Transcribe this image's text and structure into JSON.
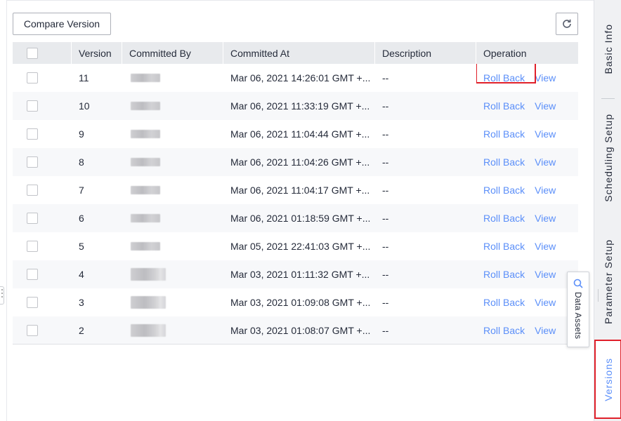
{
  "toolbar": {
    "compare_label": "Compare Version",
    "refresh_icon": "refresh-icon"
  },
  "table": {
    "headers": {
      "version": "Version",
      "committed_by": "Committed By",
      "committed_at": "Committed At",
      "description": "Description",
      "operation": "Operation"
    },
    "rows": [
      {
        "version": "11",
        "committed_at": "Mar 06, 2021 14:26:01 GMT +...",
        "description": "--",
        "rollback": "Roll Back",
        "view": "View"
      },
      {
        "version": "10",
        "committed_at": "Mar 06, 2021 11:33:19 GMT +...",
        "description": "--",
        "rollback": "Roll Back",
        "view": "View"
      },
      {
        "version": "9",
        "committed_at": "Mar 06, 2021 11:04:44 GMT +...",
        "description": "--",
        "rollback": "Roll Back",
        "view": "View"
      },
      {
        "version": "8",
        "committed_at": "Mar 06, 2021 11:04:26 GMT +...",
        "description": "--",
        "rollback": "Roll Back",
        "view": "View"
      },
      {
        "version": "7",
        "committed_at": "Mar 06, 2021 11:04:17 GMT +...",
        "description": "--",
        "rollback": "Roll Back",
        "view": "View"
      },
      {
        "version": "6",
        "committed_at": "Mar 06, 2021 01:18:59 GMT +...",
        "description": "--",
        "rollback": "Roll Back",
        "view": "View"
      },
      {
        "version": "5",
        "committed_at": "Mar 05, 2021 22:41:03 GMT +...",
        "description": "--",
        "rollback": "Roll Back",
        "view": "View"
      },
      {
        "version": "4",
        "committed_at": "Mar 03, 2021 01:11:32 GMT +...",
        "description": "--",
        "rollback": "Roll Back",
        "view": "View"
      },
      {
        "version": "3",
        "committed_at": "Mar 03, 2021 01:09:08 GMT +...",
        "description": "--",
        "rollback": "Roll Back",
        "view": "View"
      },
      {
        "version": "2",
        "committed_at": "Mar 03, 2021 01:08:07 GMT +...",
        "description": "--",
        "rollback": "Roll Back",
        "view": "View"
      }
    ]
  },
  "floating": {
    "data_assets_label": "Data Assets",
    "icon": "search-icon"
  },
  "side_tabs": {
    "basic_info": "Basic Info",
    "scheduling_setup": "Scheduling Setup",
    "parameter_setup": "Parameter Setup",
    "versions": "Versions",
    "active": "Versions"
  },
  "colors": {
    "link": "#5b8ff9",
    "highlight": "#e0202a",
    "header_bg": "#e8eaed",
    "stripe_bg": "#f7f8fa"
  }
}
